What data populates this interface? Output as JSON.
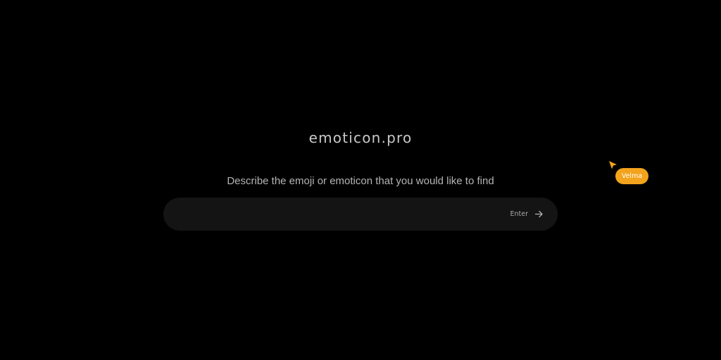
{
  "app": {
    "logo_text": "emoticon.pro"
  },
  "main": {
    "prompt": "Describe the emoji or emoticon that you would like to find",
    "search": {
      "value": "",
      "placeholder": "",
      "enter_label": "Enter",
      "enter_icon": "arrow-right-icon"
    }
  },
  "collaborator": {
    "name": "Velma",
    "color": "#f3a31c",
    "cursor_icon": "pointer-cursor-icon"
  },
  "colors": {
    "background": "#000000",
    "search_bar": "#141414",
    "accent": "#f3a31c"
  }
}
